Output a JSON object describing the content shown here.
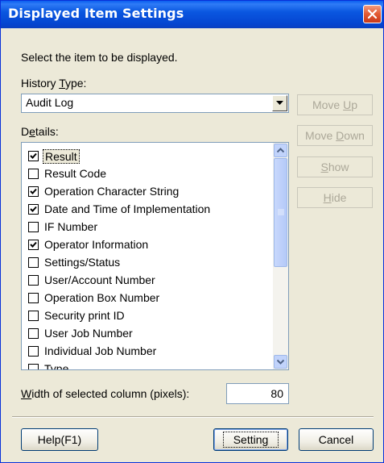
{
  "dialog": {
    "title": "Displayed Item Settings",
    "instruction": "Select the item to be displayed."
  },
  "history_type": {
    "label_pre": "History ",
    "label_key": "T",
    "label_post": "ype:",
    "selected": "Audit Log"
  },
  "details": {
    "label_pre": "D",
    "label_key": "e",
    "label_post": "tails:",
    "items": [
      {
        "label": "Result",
        "checked": true,
        "focused": true
      },
      {
        "label": "Result Code",
        "checked": false
      },
      {
        "label": "Operation Character String",
        "checked": true
      },
      {
        "label": "Date and Time of Implementation",
        "checked": true
      },
      {
        "label": "IF Number",
        "checked": false
      },
      {
        "label": "Operator Information",
        "checked": true
      },
      {
        "label": "Settings/Status",
        "checked": false
      },
      {
        "label": "User/Account Number",
        "checked": false
      },
      {
        "label": "Operation Box Number",
        "checked": false
      },
      {
        "label": "Security print ID",
        "checked": false
      },
      {
        "label": "User Job Number",
        "checked": false
      },
      {
        "label": "Individual Job Number",
        "checked": false
      },
      {
        "label": "Type",
        "checked": false
      }
    ]
  },
  "side_buttons": {
    "move_up_pre": "Move ",
    "move_up_key": "U",
    "move_up_post": "p",
    "move_down_pre": "Move ",
    "move_down_key": "D",
    "move_down_post": "own",
    "show_pre": "",
    "show_key": "S",
    "show_post": "how",
    "hide_pre": "",
    "hide_key": "H",
    "hide_post": "ide"
  },
  "column_width": {
    "label_pre": "",
    "label_key": "W",
    "label_post": "idth of selected column (pixels):",
    "value": "80"
  },
  "footer": {
    "help": "Help(F1)",
    "setting": "Setting",
    "cancel": "Cancel"
  },
  "colors": {
    "titlebar": "#0a57e0",
    "face": "#ece9d8",
    "disabled_text": "#aca899",
    "close_red": "#e25a32"
  }
}
